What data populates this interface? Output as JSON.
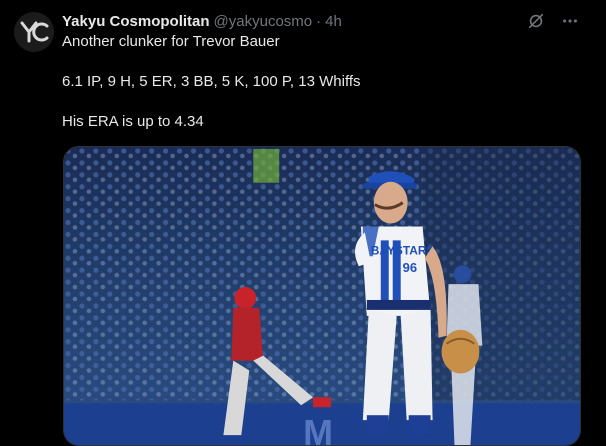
{
  "tweet": {
    "display_name": "Yakyu Cosmopolitan",
    "handle": "@yakyucosmo",
    "separator": "·",
    "time": "4h",
    "lines": [
      "Another clunker for Trevor Bauer",
      "6.1 IP, 9 H, 5 ER, 3 BB, 5 K, 100 P, 13 Whiffs",
      "His ERA is up to 4.34"
    ],
    "avatar_icon": "yc-logo-icon",
    "header_icons": [
      "grok-icon",
      "more-icon"
    ],
    "media": {
      "type": "photo",
      "jersey_text": "BAYSTARS",
      "jersey_number": "96",
      "banner_text": "M"
    }
  },
  "colors": {
    "background": "#000000",
    "primary_text": "#e7e9ea",
    "secondary_text": "#71767b",
    "team_blue": "#1f4fb8"
  }
}
